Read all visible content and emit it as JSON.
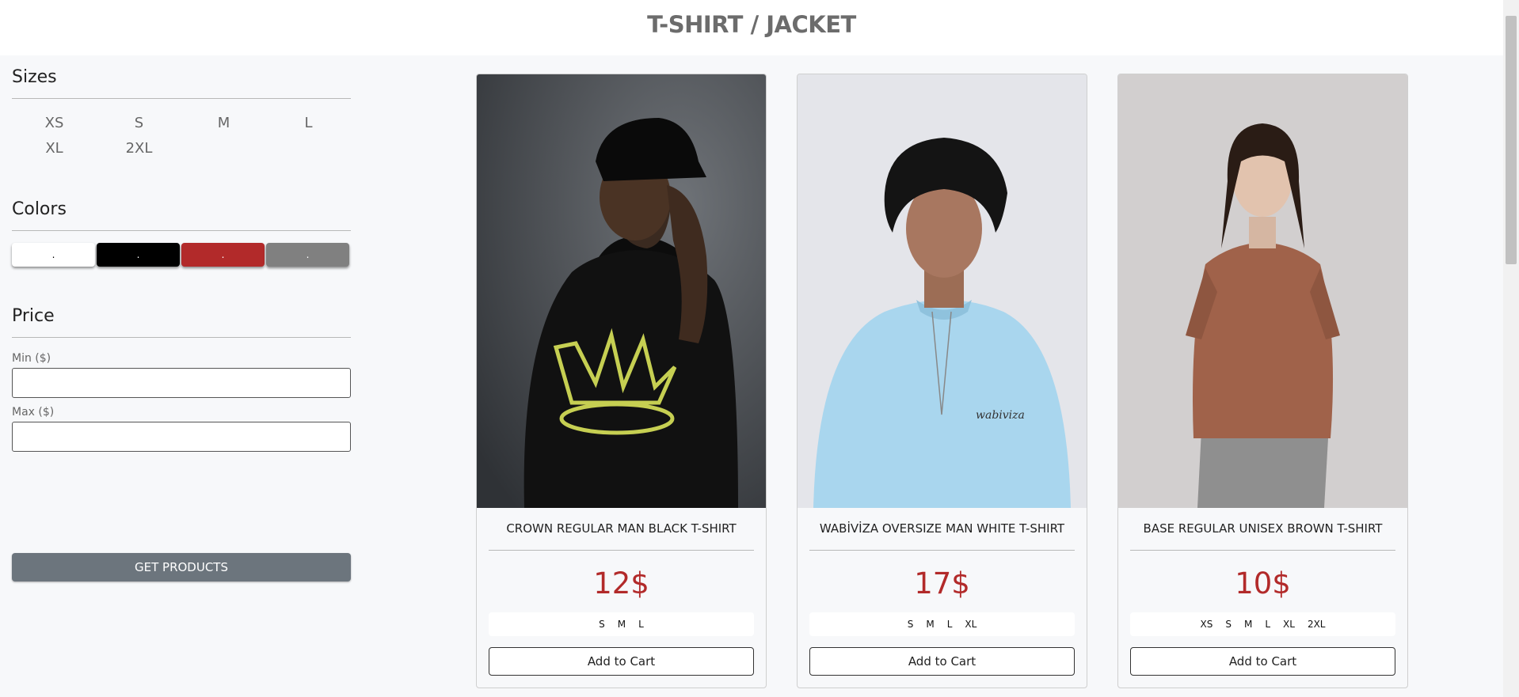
{
  "header": {
    "title": "T-SHIRT / JACKET"
  },
  "filters": {
    "sizes": {
      "title": "Sizes",
      "options": [
        "XS",
        "S",
        "M",
        "L",
        "XL",
        "2XL"
      ]
    },
    "colors": {
      "title": "Colors",
      "swatches": [
        {
          "name": "white",
          "hex": "#ffffff",
          "mark": "."
        },
        {
          "name": "black",
          "hex": "#000000",
          "mark": "."
        },
        {
          "name": "red",
          "hex": "#b22a2a",
          "mark": "."
        },
        {
          "name": "gray",
          "hex": "#808080",
          "mark": "."
        }
      ]
    },
    "price": {
      "title": "Price",
      "min_label": "Min ($)",
      "min_value": "",
      "max_label": "Max ($)",
      "max_value": ""
    },
    "submit_label": "GET PRODUCTS"
  },
  "products": [
    {
      "name": "CROWN REGULAR MAN BLACK T-SHIRT",
      "price": "12$",
      "sizes": [
        "S",
        "M",
        "L"
      ],
      "cart_label": "Add to Cart"
    },
    {
      "name": "WABİVİZA OVERSIZE MAN WHITE T-SHIRT",
      "price": "17$",
      "sizes": [
        "S",
        "M",
        "L",
        "XL"
      ],
      "cart_label": "Add to Cart"
    },
    {
      "name": "BASE REGULAR UNISEX BROWN T-SHIRT",
      "price": "10$",
      "sizes": [
        "XS",
        "S",
        "M",
        "L",
        "XL",
        "2XL"
      ],
      "cart_label": "Add to Cart"
    }
  ],
  "colors": {
    "price": "#b22a2a",
    "button": "#6c757d"
  }
}
